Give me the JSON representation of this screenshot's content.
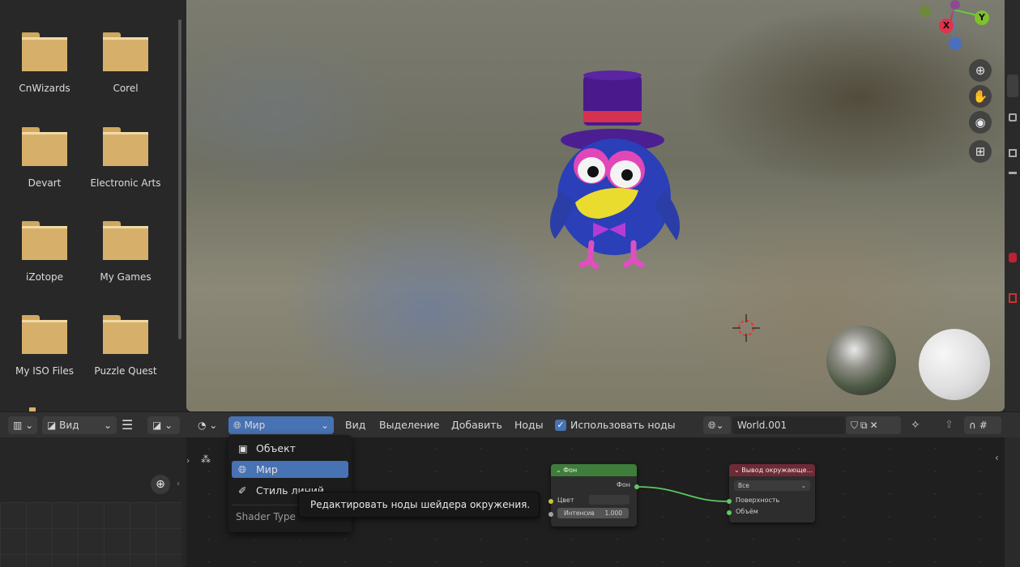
{
  "file_browser": {
    "folders": [
      {
        "name": "CnWizards"
      },
      {
        "name": "Corel"
      },
      {
        "name": "Devart"
      },
      {
        "name": "Electronic Arts"
      },
      {
        "name": "iZotope"
      },
      {
        "name": "My Games"
      },
      {
        "name": "My ISO Files"
      },
      {
        "name": "Puzzle Quest"
      }
    ]
  },
  "viewport": {
    "gizmo": {
      "x": "X",
      "y": "Y"
    },
    "nav_icons": [
      "zoom-icon",
      "hand-pan-icon",
      "camera-icon",
      "grid-perspective-icon"
    ]
  },
  "header": {
    "left_view_label": "Вид",
    "shader_type_selected": "Мир",
    "menu": {
      "view": "Вид",
      "select": "Выделение",
      "add": "Добавить",
      "nodes": "Ноды"
    },
    "use_nodes_label": "Использовать ноды",
    "use_nodes_checked": true,
    "world_name": "World.001"
  },
  "dropdown": {
    "items": [
      {
        "label": "Объект",
        "icon": "object-icon",
        "selected": false
      },
      {
        "label": "Мир",
        "icon": "world-icon",
        "selected": true
      },
      {
        "label": "Стиль линий",
        "icon": "linestyle-icon",
        "selected": false
      }
    ],
    "footer": "Shader Type"
  },
  "tooltip": {
    "text": "Редактировать ноды шейдера окружения."
  },
  "nodes": {
    "background": {
      "title": "Фон",
      "output": "Фон",
      "color_label": "Цвет",
      "strength_label": "Интенсив",
      "strength_value": "1.000",
      "header_color": "#3f7d3a"
    },
    "world_output": {
      "title": "Вывод окружающе...",
      "target": "Все",
      "surface_label": "Поверхность",
      "volume_label": "Объём",
      "header_color": "#6e2a35"
    }
  },
  "colors": {
    "accent": "#4772b3",
    "socket_yellow": "#c7c729",
    "socket_green": "#63c763",
    "socket_grey": "#a1a1a1"
  }
}
